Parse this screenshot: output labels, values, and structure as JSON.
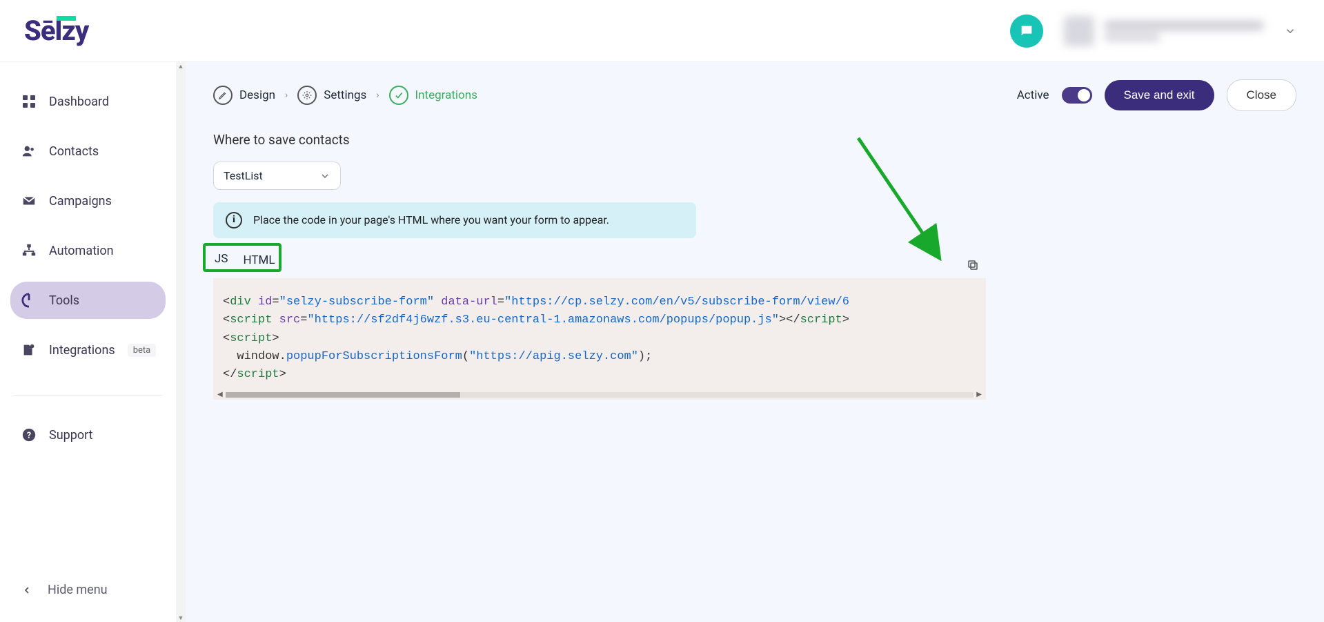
{
  "sidebar": {
    "items": [
      {
        "label": "Dashboard"
      },
      {
        "label": "Contacts"
      },
      {
        "label": "Campaigns"
      },
      {
        "label": "Automation"
      },
      {
        "label": "Tools"
      },
      {
        "label": "Integrations",
        "badge": "beta"
      }
    ],
    "support": "Support",
    "hide": "Hide menu"
  },
  "breadcrumbs": {
    "design": "Design",
    "settings": "Settings",
    "integrations": "Integrations"
  },
  "topbar": {
    "active": "Active",
    "save": "Save and exit",
    "close": "Close"
  },
  "section": {
    "title": "Where to save contacts",
    "select_value": "TestList"
  },
  "info": {
    "text": "Place the code in your page's HTML where you want your form to appear."
  },
  "tabs": {
    "js": "JS",
    "html": "HTML"
  },
  "code": {
    "l1_t1": "<",
    "l1_tag1": "div",
    "l1_sp1": " ",
    "l1_a1": "id",
    "l1_op1": "=",
    "l1_v1": "\"selzy-subscribe-form\"",
    "l1_sp2": " ",
    "l1_a2": "data-url",
    "l1_op2": "=",
    "l1_v2": "\"https://cp.selzy.com/en/v5/subscribe-form/view/6",
    "l2_t1": "<",
    "l2_tag1": "script",
    "l2_sp1": " ",
    "l2_a1": "src",
    "l2_op1": "=",
    "l2_v1": "\"https://sf2df4j6wzf.s3.eu-central-1.amazonaws.com/popups/popup.js\"",
    "l2_t2": "></",
    "l2_tag2": "script",
    "l2_t3": ">",
    "l3_t1": "<",
    "l3_tag1": "script",
    "l3_t2": ">",
    "l4_indent": "  ",
    "l4_obj": "window",
    "l4_dot": ".",
    "l4_prop": "popupForSubscriptionsForm",
    "l4_p1": "(",
    "l4_arg": "\"https://apig.selzy.com\"",
    "l4_p2": ");",
    "l5_t1": "</",
    "l5_tag1": "script",
    "l5_t2": ">"
  }
}
